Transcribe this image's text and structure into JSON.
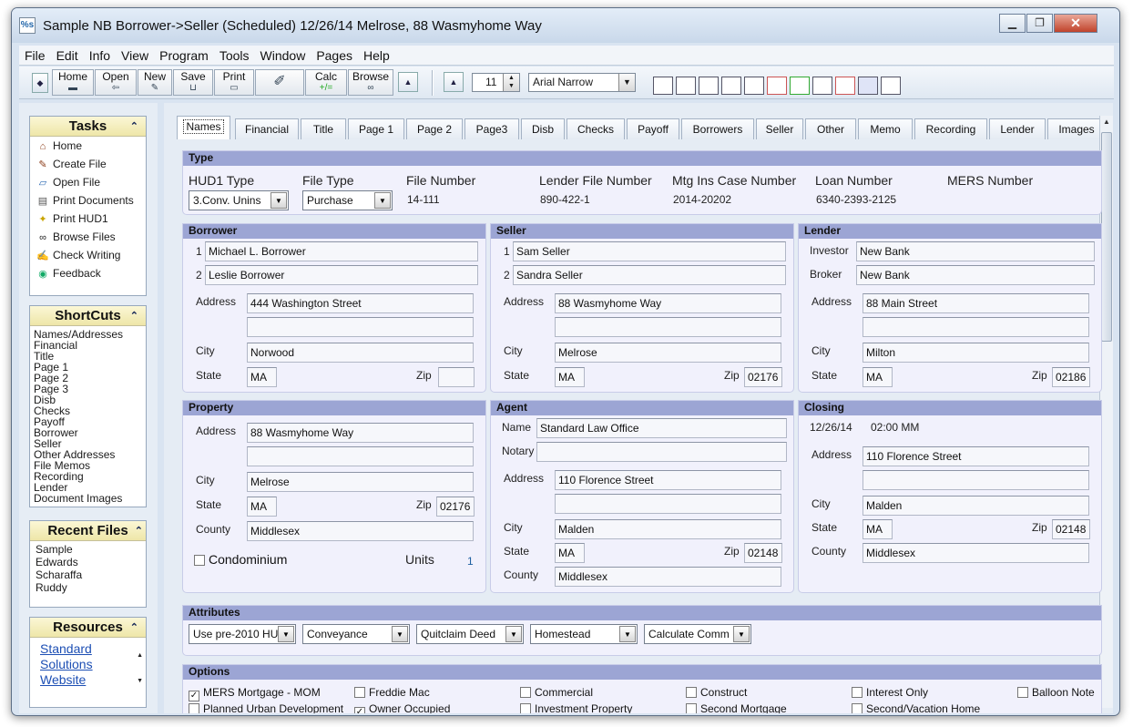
{
  "window": {
    "title": "Sample NB Borrower->Seller (Scheduled) 12/26/14 Melrose, 88 Wasmyhome Way",
    "app_icon_text": "%s",
    "minimize": "▁",
    "maximize": "❐",
    "close": "✕"
  },
  "menu": [
    "File",
    "Edit",
    "Info",
    "View",
    "Program",
    "Tools",
    "Window",
    "Pages",
    "Help"
  ],
  "toolbar": {
    "buttons": [
      {
        "label": "Home",
        "icon": "home-icon"
      },
      {
        "label": "Open",
        "icon": "open-folder-icon"
      },
      {
        "label": "New",
        "icon": "new-file-icon"
      },
      {
        "label": "Save",
        "icon": "save-icon"
      },
      {
        "label": "Print",
        "icon": "print-icon"
      },
      {
        "label": "Calc",
        "icon": "calculator-icon"
      },
      {
        "label": "Browse",
        "icon": "binoculars-icon"
      }
    ],
    "calc_glyph": "+/=",
    "font_size": "11",
    "font_name": "Arial Narrow"
  },
  "sidebar": {
    "tasks_title": "Tasks",
    "tasks": [
      {
        "label": "Home",
        "icon": "house-icon",
        "glyph": "⌂"
      },
      {
        "label": "Create File",
        "icon": "create-file-icon",
        "glyph": "✎"
      },
      {
        "label": "Open File",
        "icon": "open-file-icon",
        "glyph": "▱"
      },
      {
        "label": "Print Documents",
        "icon": "print-documents-icon",
        "glyph": "▤"
      },
      {
        "label": "Print HUD1",
        "icon": "print-hud1-icon",
        "glyph": "✦"
      },
      {
        "label": "Browse Files",
        "icon": "binoculars-icon",
        "glyph": "∞"
      },
      {
        "label": "Check Writing",
        "icon": "check-writing-icon",
        "glyph": "✍"
      },
      {
        "label": "Feedback",
        "icon": "feedback-icon",
        "glyph": "◉"
      }
    ],
    "shortcuts_title": "ShortCuts",
    "shortcuts": [
      "Names/Addresses",
      "Financial",
      "Title",
      "Page 1",
      "Page 2",
      "Page 3",
      "Disb",
      "Checks",
      "Payoff",
      "Borrower",
      "Seller",
      "Other Addresses",
      "File Memos",
      "Recording",
      "Lender",
      "Document Images"
    ],
    "recent_title": "Recent Files",
    "recent": [
      "Sample",
      "Edwards",
      "Scharaffa",
      "Ruddy"
    ],
    "resources_title": "Resources",
    "resources_link": [
      "Standard",
      "Solutions",
      "Website"
    ],
    "collapse_glyph": "⌃"
  },
  "tabs": [
    "Names",
    "Financial",
    "Title",
    "Page 1",
    "Page 2",
    "Page3",
    "Disb",
    "Checks",
    "Payoff",
    "Borrowers",
    "Seller",
    "Other",
    "Memo",
    "Recording",
    "Lender",
    "Images"
  ],
  "type": {
    "header": "Type",
    "hud1_type_label": "HUD1 Type",
    "hud1_type": "3.Conv. Unins",
    "file_type_label": "File Type",
    "file_type": "Purchase",
    "file_number_label": "File Number",
    "file_number": "14-111",
    "lender_file_number_label": "Lender File Number",
    "lender_file_number": "890-422-1",
    "mtg_ins_label": "Mtg Ins Case Number",
    "mtg_ins": "2014-20202",
    "loan_number_label": "Loan Number",
    "loan_number": "6340-2393-2125",
    "mers_number_label": "MERS Number",
    "mers_number": ""
  },
  "labels": {
    "address": "Address",
    "city": "City",
    "state": "State",
    "zip": "Zip",
    "county": "County",
    "n1": "1",
    "n2": "2"
  },
  "borrower": {
    "header": "Borrower",
    "name1": "Michael L. Borrower",
    "name2": "Leslie Borrower",
    "address1": "444 Washington Street",
    "address2": "",
    "city": "Norwood",
    "state": "MA",
    "zip": ""
  },
  "seller": {
    "header": "Seller",
    "name1": "Sam Seller",
    "name2": "Sandra Seller",
    "address1": "88 Wasmyhome Way",
    "address2": "",
    "city": "Melrose",
    "state": "MA",
    "zip": "02176"
  },
  "lender": {
    "header": "Lender",
    "investor_label": "Investor",
    "investor": "New Bank",
    "broker_label": "Broker",
    "broker": "New Bank",
    "address1": "88 Main Street",
    "address2": "",
    "city": "Milton",
    "state": "MA",
    "zip": "02186"
  },
  "property": {
    "header": "Property",
    "address1": "88 Wasmyhome Way",
    "address2": "",
    "city": "Melrose",
    "state": "MA",
    "zip": "02176",
    "county": "Middlesex",
    "condo_label": "Condominium",
    "units_label": "Units",
    "units": "1"
  },
  "agent": {
    "header": "Agent",
    "name_label": "Name",
    "name": "Standard Law Office",
    "notary_label": "Notary",
    "notary": "",
    "address1": "110 Florence Street",
    "address2": "",
    "city": "Malden",
    "state": "MA",
    "zip": "02148",
    "county": "Middlesex"
  },
  "closing": {
    "header": "Closing",
    "date": "12/26/14",
    "time": "02:00 MM",
    "address1": "110 Florence Street",
    "address2": "",
    "city": "Malden",
    "state": "MA",
    "zip": "02148",
    "county": "Middlesex"
  },
  "attributes": {
    "header": "Attributes",
    "values": [
      "Use pre-2010 HU",
      "Conveyance",
      "Quitclaim Deed",
      "Homestead",
      "Calculate Comm"
    ]
  },
  "options": {
    "header": "Options",
    "items": [
      {
        "label": "MERS  Mortgage - MOM",
        "checked": true
      },
      {
        "label": "Freddie Mac",
        "checked": false
      },
      {
        "label": "Commercial",
        "checked": false
      },
      {
        "label": "Construct",
        "checked": false
      },
      {
        "label": "Interest Only",
        "checked": false
      },
      {
        "label": "Balloon Note",
        "checked": false
      },
      {
        "label": "Planned Urban Development",
        "checked": false
      },
      {
        "label": "Owner Occupied",
        "checked": true
      },
      {
        "label": "Investment Property",
        "checked": false
      },
      {
        "label": "Second Mortgage",
        "checked": false
      },
      {
        "label": "Second/Vacation Home",
        "checked": false
      }
    ],
    "check_glyph": "✓"
  },
  "glyphs": {
    "dropdown": "▼",
    "up": "▲",
    "down": "▼",
    "spin": "◆"
  },
  "colors": {
    "section_header": "#9ca5d4",
    "section_bg": "#f1f1fc",
    "sidebar_head": "#eee6a8",
    "link": "#1d4fb4"
  }
}
